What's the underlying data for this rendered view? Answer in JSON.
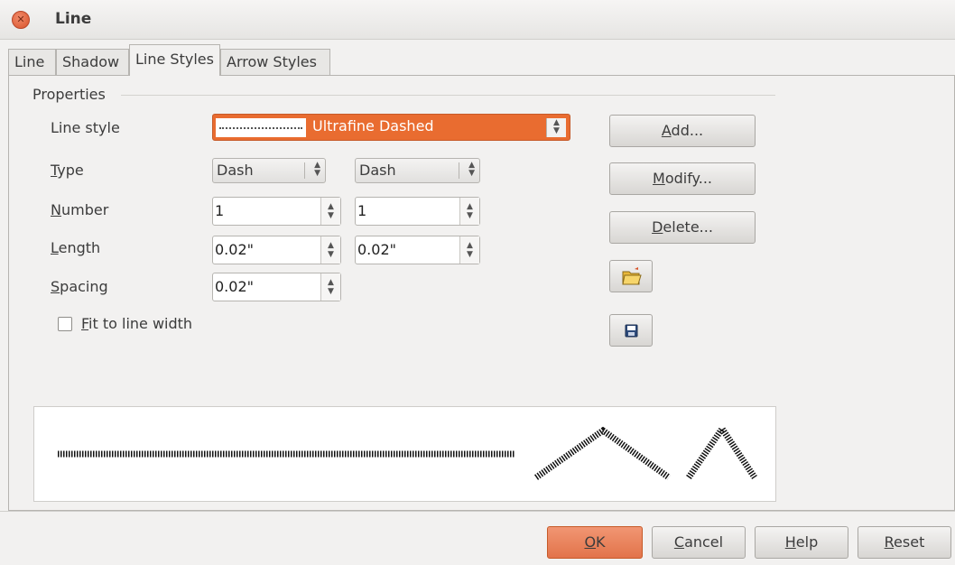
{
  "window": {
    "title": "Line"
  },
  "tabs": [
    {
      "label": "Line"
    },
    {
      "label": "Shadow"
    },
    {
      "label": "Line Styles"
    },
    {
      "label": "Arrow Styles"
    }
  ],
  "properties": {
    "heading": "Properties",
    "line_style": {
      "label": "Line style",
      "value": "Ultrafine Dashed"
    },
    "type": {
      "label": "Type",
      "value1": "Dash",
      "value2": "Dash"
    },
    "number": {
      "label": "Number",
      "value1": "1",
      "value2": "1"
    },
    "length": {
      "label": "Length",
      "value1": "0.02\"",
      "value2": "0.02\""
    },
    "spacing": {
      "label": "Spacing",
      "value": "0.02\""
    },
    "fit_to_line_width": {
      "label": "Fit to line width",
      "checked": false
    }
  },
  "side_buttons": {
    "add": "Add...",
    "modify": "Modify...",
    "delete": "Delete..."
  },
  "icon_buttons": {
    "load": "open-folder-icon",
    "save": "floppy-disk-icon"
  },
  "footer": {
    "ok": "OK",
    "cancel": "Cancel",
    "help": "Help",
    "reset": "Reset"
  },
  "colors": {
    "accent": "#e96c30",
    "ok_button": "#ea7e55"
  }
}
